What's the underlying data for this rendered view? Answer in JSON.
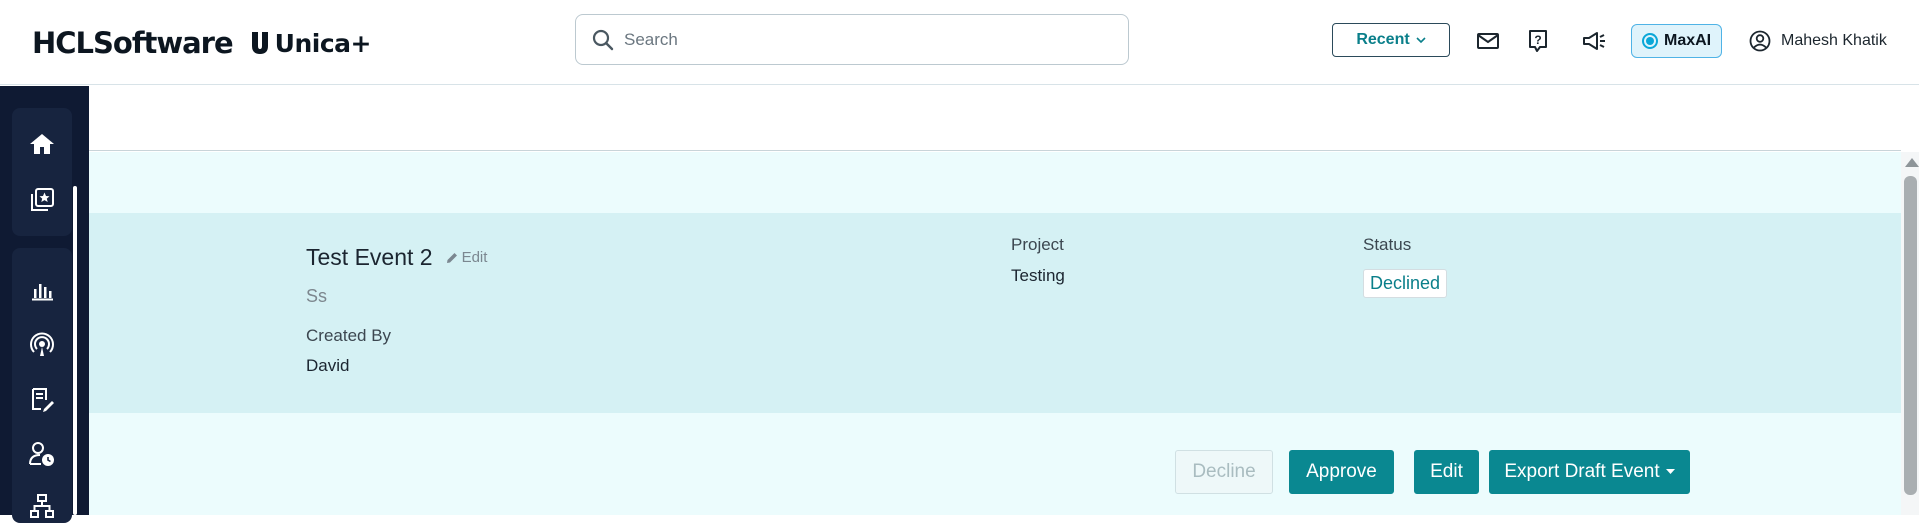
{
  "header": {
    "brand_hcl": "HCLSoftware",
    "brand_unica": "Unica+",
    "search_placeholder": "Search",
    "recent_label": "Recent",
    "maxai_label": "MaxAI",
    "user_name": "Mahesh Khatik"
  },
  "nav": {
    "items": [
      "home-icon",
      "favorites-icon",
      "analytics-icon",
      "broadcast-icon",
      "plans-icon",
      "user-clock-icon",
      "hierarchy-icon"
    ]
  },
  "event": {
    "title": "Test Event 2",
    "edit_label": "Edit",
    "subtitle": "Ss",
    "created_by_label": "Created By",
    "created_by_value": "David",
    "project_label": "Project",
    "project_value": "Testing",
    "status_label": "Status",
    "status_value": "Declined"
  },
  "actions": {
    "decline": "Decline",
    "approve": "Approve",
    "edit": "Edit",
    "export": "Export Draft Event"
  },
  "colors": {
    "accent": "#0a8891",
    "nav_bg": "#0f1a33",
    "band_bg": "#d5f1f4",
    "panel_bg": "#ecfcfd"
  }
}
